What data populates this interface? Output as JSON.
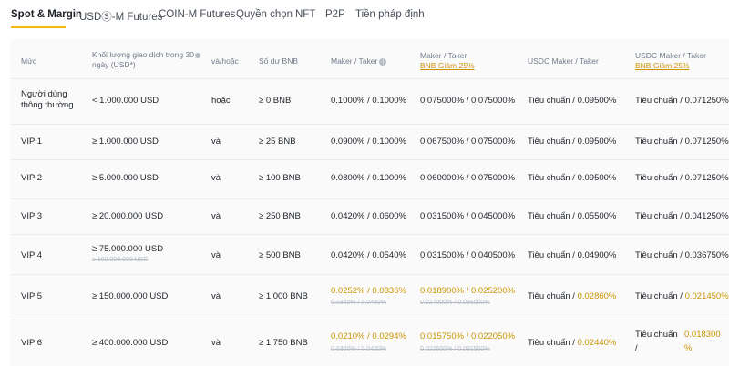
{
  "tabs": [
    {
      "label": "Spot & Margin",
      "active": true
    },
    {
      "label": "USDⓈ-M Futures"
    },
    {
      "label": "COIN-M Futures"
    },
    {
      "label": "Quyền chọn"
    },
    {
      "label": "NFT"
    },
    {
      "label": "P2P"
    },
    {
      "label": "Tiền pháp định"
    }
  ],
  "headers": {
    "level": "Mức",
    "volume_line1": "Khối lượng giao dịch trong 30",
    "volume_line2": "ngày (USD*)",
    "andor": "và/hoặc",
    "bnb": "Số dư BNB",
    "maker_taker": "Maker / Taker",
    "maker_taker2": "Maker / Taker",
    "maker_taker2_sub": "BNB Giảm 25%",
    "usdc": "USDC Maker / Taker",
    "usdc2": "USDC Maker / Taker",
    "usdc2_sub": "BNB Giảm 25%"
  },
  "rows": [
    {
      "level": "Người dùng thông thường",
      "volume": "< 1.000.000 USD",
      "andor": "hoặc",
      "bnb": "≥ 0 BNB",
      "mt": "0.1000% / 0.1000%",
      "mt_bnb": "0.075000% / 0.075000%",
      "usdc_label": "Tiêu chuẩn",
      "usdc": "0.09500%",
      "usdc_bnb_label": "Tiêu chuẩn",
      "usdc_bnb": "0.071250%"
    },
    {
      "level": "VIP 1",
      "volume": "≥ 1.000.000 USD",
      "andor": "và",
      "bnb": "≥ 25 BNB",
      "mt": "0.0900% / 0.1000%",
      "mt_bnb": "0.067500% / 0.075000%",
      "usdc_label": "Tiêu chuẩn",
      "usdc": "0.09500%",
      "usdc_bnb_label": "Tiêu chuẩn",
      "usdc_bnb": "0.071250%"
    },
    {
      "level": "VIP 2",
      "volume": "≥ 5.000.000 USD",
      "andor": "và",
      "bnb": "≥ 100 BNB",
      "mt": "0.0800% / 0.1000%",
      "mt_bnb": "0.060000% / 0.075000%",
      "usdc_label": "Tiêu chuẩn",
      "usdc": "0.09500%",
      "usdc_bnb_label": "Tiêu chuẩn",
      "usdc_bnb": "0.071250%"
    },
    {
      "level": "VIP 3",
      "volume": "≥ 20.000.000 USD",
      "andor": "và",
      "bnb": "≥ 250 BNB",
      "mt": "0.0420% / 0.0600%",
      "mt_bnb": "0.031500% / 0.045000%",
      "usdc_label": "Tiêu chuẩn",
      "usdc": "0.05500%",
      "usdc_bnb_label": "Tiêu chuẩn",
      "usdc_bnb": "0.041250%"
    },
    {
      "level": "VIP 4",
      "volume": "≥ 75.000.000 USD",
      "volume_old": "≥ 100.000.000 USD",
      "andor": "và",
      "bnb": "≥ 500 BNB",
      "mt": "0.0420% / 0.0540%",
      "mt_bnb": "0.031500% / 0.040500%",
      "usdc_label": "Tiêu chuẩn",
      "usdc": "0.04900%",
      "usdc_bnb_label": "Tiêu chuẩn",
      "usdc_bnb": "0.036750%"
    },
    {
      "level": "VIP 5",
      "volume": "≥ 150.000.000 USD",
      "andor": "và",
      "bnb": "≥ 1.000 BNB",
      "mt": "0.0252% / 0.0336%",
      "mt_old": "0.0360% / 0.0480%",
      "mt_bnb": "0.018900% / 0.025200%",
      "mt_bnb_old": "0.027000% / 0.036000%",
      "usdc_label": "Tiêu chuẩn",
      "usdc": "0.02860%",
      "usdc_bnb_label": "Tiêu chuẩn",
      "usdc_bnb": "0.021450%"
    },
    {
      "level": "VIP 6",
      "volume": "≥ 400.000.000 USD",
      "andor": "và",
      "bnb": "≥ 1.750 BNB",
      "mt": "0.0210% / 0.0294%",
      "mt_old": "0.0300% / 0.0420%",
      "mt_bnb": "0.015750% / 0.022050%",
      "mt_bnb_old": "0.022500% / 0.031500%",
      "usdc_label": "Tiêu chuẩn",
      "usdc": "0.02440%",
      "usdc_bnb_label": "Tiêu chuẩn",
      "usdc_bnb_slash": "/",
      "usdc_bnb": "0.018300",
      "usdc_bnb_pct": "%"
    }
  ],
  "colors": {
    "accent": "#f0b90b",
    "gold_text": "#c99400",
    "muted": "#707a8a"
  }
}
